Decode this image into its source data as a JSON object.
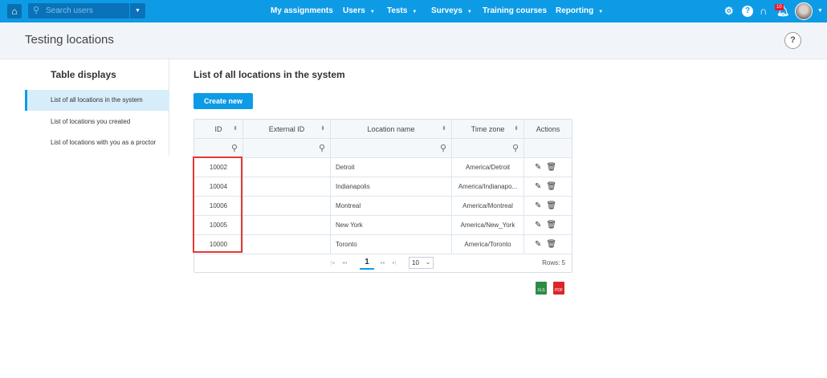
{
  "nav": {
    "search_placeholder": "Search users",
    "menu": [
      "My assignments",
      "Users",
      "Tests",
      "Surveys",
      "Training courses",
      "Reporting"
    ],
    "notification_count": "10",
    "accent": "#0e9be6"
  },
  "header": {
    "title": "Testing locations",
    "help": "?"
  },
  "sidebar": {
    "title": "Table displays",
    "items": [
      {
        "label": "List of all locations in the system",
        "active": true
      },
      {
        "label": "List of locations you created"
      },
      {
        "label": "List of locations with you as a proctor"
      }
    ]
  },
  "main": {
    "title": "List of all locations in the system",
    "create_button": "Create new",
    "columns": [
      "ID",
      "External ID",
      "Location name",
      "Time zone",
      "Actions"
    ],
    "rows": [
      {
        "id": "10002",
        "external_id": "",
        "name": "Detroit",
        "tz": "America/Detroit"
      },
      {
        "id": "10004",
        "external_id": "",
        "name": "Indianapolis",
        "tz": "America/Indianapo..."
      },
      {
        "id": "10006",
        "external_id": "",
        "name": "Montreal",
        "tz": "America/Montreal"
      },
      {
        "id": "10005",
        "external_id": "",
        "name": "New York",
        "tz": "America/New_York"
      },
      {
        "id": "10000",
        "external_id": "",
        "name": "Toronto",
        "tz": "America/Toronto"
      }
    ],
    "pagination": {
      "current_page": "1",
      "page_size": "10",
      "rows_label": "Rows: 5"
    },
    "export": {
      "excel": "XLS",
      "pdf": "PDF"
    }
  }
}
